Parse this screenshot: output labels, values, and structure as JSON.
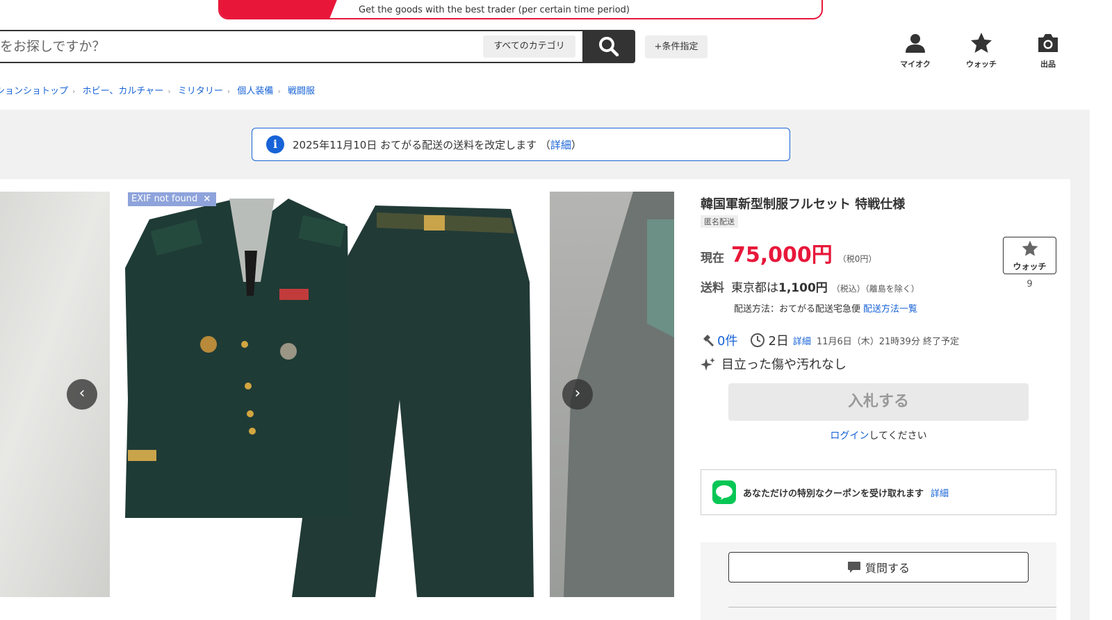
{
  "banner": {
    "text": "Get the goods with the best trader (per certain time period)"
  },
  "search": {
    "placeholder": "をお探しですか？",
    "category": "すべてのカテゴリ",
    "conditions": "+条件指定"
  },
  "header_icons": {
    "myauc": "マイオク",
    "watch": "ウォッチ",
    "sell": "出品"
  },
  "breadcrumb": [
    "ションショトップ",
    "ホビー、カルチャー",
    "ミリタリー",
    "個人装備",
    "戦闘服"
  ],
  "notice": {
    "text": "2025年11月10日 おてがる配送の送料を改定します （",
    "link": "詳細",
    "close": "）"
  },
  "images": {
    "exif_badge": "EXIF not found",
    "exif_close": "×"
  },
  "item": {
    "title": "韓国軍新型制服フルセット 特戦仕様",
    "badge": "匿名配送",
    "price_label": "現在",
    "price": "75,000円",
    "tax": "（税0円）",
    "watch_label": "ウォッチ",
    "watch_count": "9",
    "shipping_label": "送料",
    "shipping_prefix": "東京都は",
    "shipping_amount": "1,100円",
    "shipping_note": "（税込）（離島を除く）",
    "method_text": "配送方法：おてがる配送宅急便",
    "method_link": "配送方法一覧",
    "bids": "0件",
    "days": "2日",
    "detail_link": "詳細",
    "end_time": "11月6日（木）21時39分 終了予定",
    "condition": "目立った傷や汚れなし",
    "bid_button": "入札する",
    "login_link": "ログイン",
    "login_suffix": "してください"
  },
  "line_coupon": {
    "icon_text": "LINE",
    "text": "あなただけの特別なクーポンを受け取れます",
    "link": "詳細"
  },
  "question_button": "質問する",
  "colors": {
    "accent_red": "#e8173a",
    "link_blue": "#1763d7",
    "line_green": "#06c755"
  }
}
